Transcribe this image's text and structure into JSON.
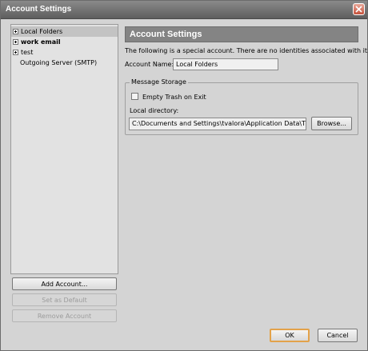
{
  "window": {
    "title": "Account Settings"
  },
  "tree": {
    "items": [
      {
        "label": "Local Folders",
        "selected": true,
        "bold": false,
        "expandable": true
      },
      {
        "label": "work email",
        "selected": false,
        "bold": true,
        "expandable": true
      },
      {
        "label": "test",
        "selected": false,
        "bold": false,
        "expandable": true
      },
      {
        "label": "Outgoing Server (SMTP)",
        "selected": false,
        "bold": false,
        "expandable": false
      }
    ]
  },
  "buttons": {
    "add_account": "Add Account...",
    "set_default": "Set as Default",
    "remove_account": "Remove Account",
    "browse": "Browse...",
    "ok": "OK",
    "cancel": "Cancel"
  },
  "panel": {
    "header": "Account Settings",
    "description": "The following is a special account. There are no identities associated with it.",
    "account_name_label": "Account Name:",
    "account_name_value": "Local Folders",
    "storage_group": "Message Storage",
    "empty_trash_label": "Empty Trash on Exit",
    "empty_trash_checked": false,
    "local_dir_label": "Local directory:",
    "local_dir_value": "C:\\Documents and Settings\\tvalora\\Application Data\\Thunde"
  }
}
